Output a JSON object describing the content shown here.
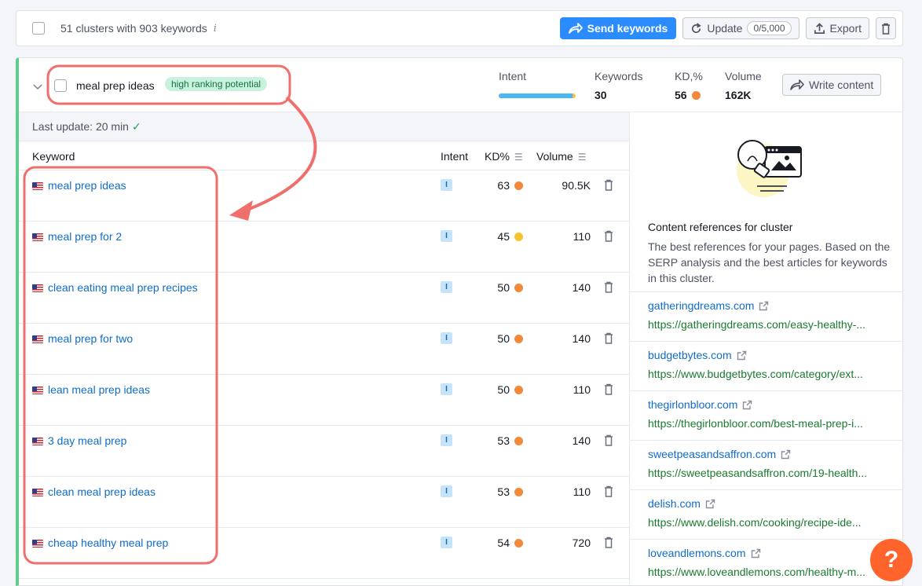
{
  "topbar": {
    "summary": "51 clusters with 903 keywords",
    "send_label": "Send keywords",
    "update_label": "Update",
    "update_counter": "0/5,000",
    "export_label": "Export"
  },
  "cluster": {
    "name": "meal prep ideas",
    "badge": "high ranking potential",
    "metrics": {
      "intent_label": "Intent",
      "keywords_label": "Keywords",
      "keywords_value": "30",
      "kd_label": "KD,%",
      "kd_value": "56",
      "volume_label": "Volume",
      "volume_value": "162K"
    },
    "write_label": "Write content",
    "last_update": "Last update: 20 min"
  },
  "table": {
    "headers": {
      "keyword": "Keyword",
      "intent": "Intent",
      "kd": "KD%",
      "volume": "Volume"
    },
    "rows": [
      {
        "keyword": "meal prep ideas",
        "intent": "I",
        "kd": "63",
        "kd_color": "#f3893a",
        "volume": "90.5K"
      },
      {
        "keyword": "meal prep for 2",
        "intent": "I",
        "kd": "45",
        "kd_color": "#f5c42c",
        "volume": "110"
      },
      {
        "keyword": "clean eating meal prep recipes",
        "intent": "I",
        "kd": "50",
        "kd_color": "#f3893a",
        "volume": "140"
      },
      {
        "keyword": "meal prep for two",
        "intent": "I",
        "kd": "50",
        "kd_color": "#f3893a",
        "volume": "140"
      },
      {
        "keyword": "lean meal prep ideas",
        "intent": "I",
        "kd": "50",
        "kd_color": "#f3893a",
        "volume": "110"
      },
      {
        "keyword": "3 day meal prep",
        "intent": "I",
        "kd": "53",
        "kd_color": "#f3893a",
        "volume": "140"
      },
      {
        "keyword": "clean meal prep ideas",
        "intent": "I",
        "kd": "53",
        "kd_color": "#f3893a",
        "volume": "110"
      },
      {
        "keyword": "cheap healthy meal prep",
        "intent": "I",
        "kd": "54",
        "kd_color": "#f3893a",
        "volume": "720"
      }
    ]
  },
  "sidebar": {
    "title": "Content references for cluster",
    "description": "The best references for your pages. Based on the SERP analysis and the best articles for keywords in this cluster.",
    "refs": [
      {
        "domain": "gatheringdreams.com",
        "url": "https://gatheringdreams.com/easy-healthy-..."
      },
      {
        "domain": "budgetbytes.com",
        "url": "https://www.budgetbytes.com/category/ext..."
      },
      {
        "domain": "thegirlonbloor.com",
        "url": "https://thegirlonbloor.com/best-meal-prep-i..."
      },
      {
        "domain": "sweetpeasandsaffron.com",
        "url": "https://sweetpeasandsaffron.com/19-health..."
      },
      {
        "domain": "delish.com",
        "url": "https://www.delish.com/cooking/recipe-ide..."
      },
      {
        "domain": "loveandlemons.com",
        "url": "https://www.loveandlemons.com/healthy-m..."
      }
    ]
  },
  "help": {
    "label": "?"
  },
  "colors": {
    "accent": "#2b8cff",
    "annotation": "#ef6f6c",
    "cluster_border": "#5ecd8c",
    "help": "#ff642d"
  }
}
